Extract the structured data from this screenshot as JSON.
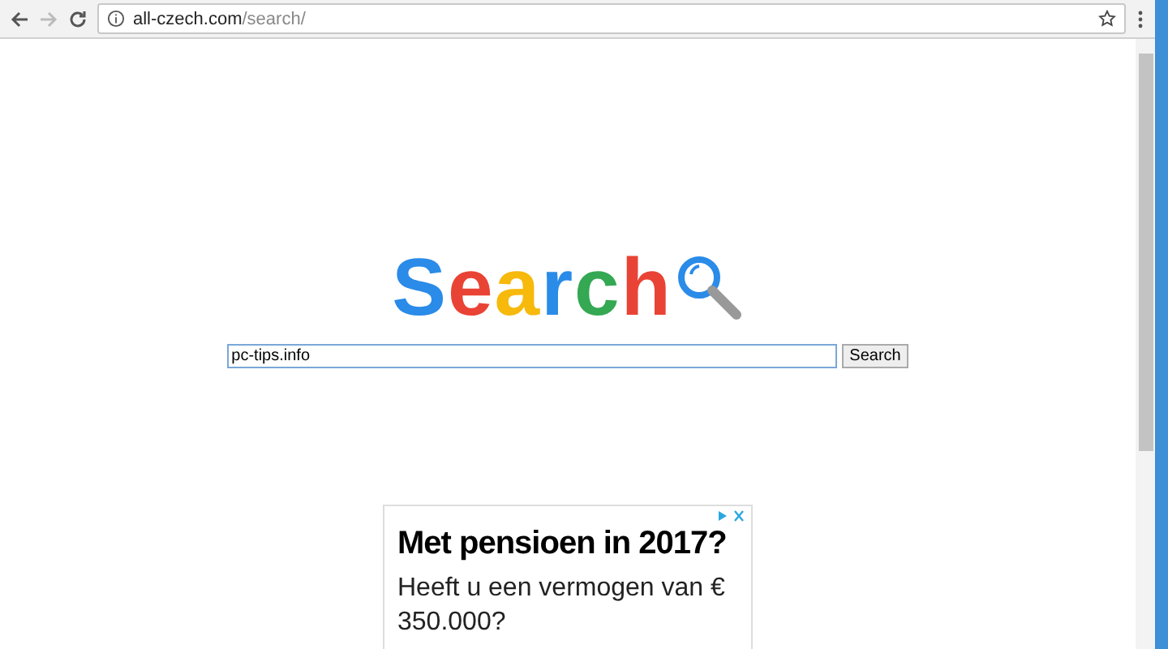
{
  "browser": {
    "url_host": "all-czech.com",
    "url_path": "/search/"
  },
  "logo": {
    "letters": [
      {
        "text": "S",
        "color": "#2a8be8"
      },
      {
        "text": "e",
        "color": "#e94335"
      },
      {
        "text": "a",
        "color": "#f6b90c"
      },
      {
        "text": "r",
        "color": "#2a8be8"
      },
      {
        "text": "c",
        "color": "#34a853"
      },
      {
        "text": "h",
        "color": "#e94335"
      }
    ]
  },
  "search": {
    "value": "pc-tips.info",
    "button": "Search"
  },
  "ad": {
    "headline": "Met pensioen in 2017?",
    "body": "Heeft u een vermogen van € 350.000?"
  }
}
